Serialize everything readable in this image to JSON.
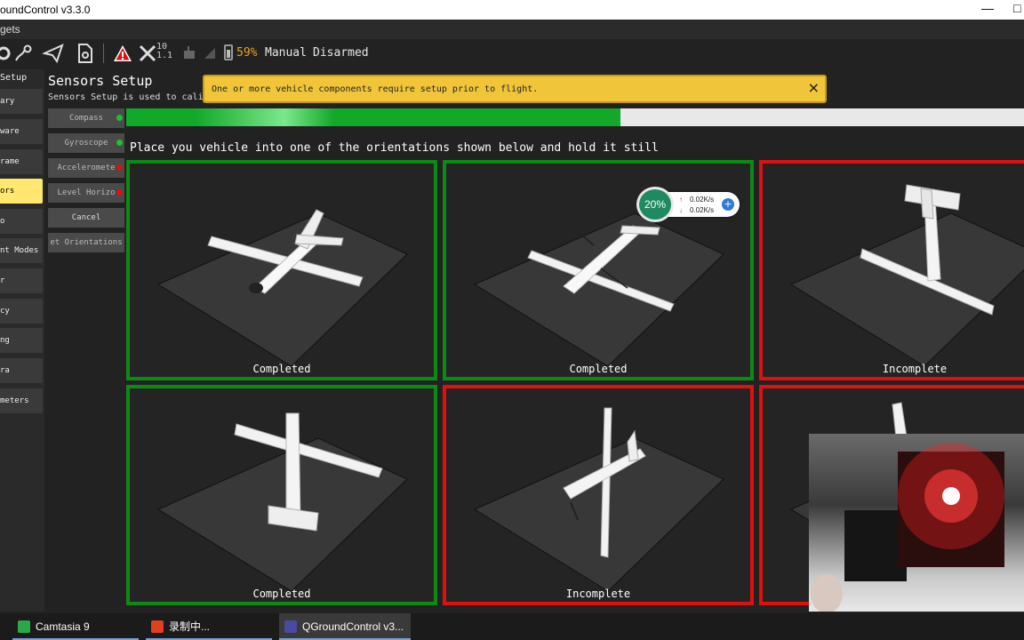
{
  "window": {
    "title": "oundControl v3.3.0",
    "min": "—",
    "max": "□"
  },
  "menubar": {
    "label": "gets"
  },
  "toolbar": {
    "gps_sats": "10",
    "gps_hdop": "1.1",
    "battery_pct": "59%",
    "flight_mode": "Manual",
    "arm_state": "Disarmed",
    "icons": [
      "gear-icon",
      "waypoint-icon",
      "send-icon",
      "document-icon",
      "warning-icon",
      "gps-icon",
      "signal-icon",
      "battery-icon"
    ]
  },
  "nav": {
    "header": "Setup",
    "items": [
      "ary",
      "ware",
      "rame",
      "ors",
      "o",
      "nt Modes",
      "r",
      "cy",
      "ng",
      "ra",
      "meters"
    ],
    "active_index": 3
  },
  "subnav": {
    "items": [
      {
        "label": "Compass",
        "status": "ok"
      },
      {
        "label": "Gyroscope",
        "status": "ok"
      },
      {
        "label": "Acceleromete",
        "status": "needed"
      },
      {
        "label": "Level Horizo",
        "status": "needed"
      },
      {
        "label": "Cancel",
        "status": ""
      },
      {
        "label": "et Orientations",
        "status": ""
      }
    ]
  },
  "page": {
    "title": "Sensors Setup",
    "description": "Sensors Setup is used to calibr",
    "banner": "One or more vehicle components require setup prior to flight.",
    "banner_close": "×",
    "progress": 0.55,
    "instruction": "Place you vehicle into one of the orientations shown below and hold it still"
  },
  "orientations": [
    {
      "status": "Completed",
      "done": true,
      "pose": "level"
    },
    {
      "status": "Completed",
      "done": true,
      "pose": "upside-down"
    },
    {
      "status": "Incomplete",
      "done": false,
      "pose": "nose-down"
    },
    {
      "status": "Completed",
      "done": true,
      "pose": "nose-up"
    },
    {
      "status": "Incomplete",
      "done": false,
      "pose": "left-side"
    },
    {
      "status": "",
      "done": false,
      "pose": "right-side"
    }
  ],
  "netspeed": {
    "percent": "20%",
    "up": "0.02K/s",
    "down": "0.02K/s"
  },
  "taskbar": {
    "items": [
      {
        "label": "Camtasia 9",
        "color": "#2aa84a"
      },
      {
        "label": "录制中...",
        "color": "#e04020"
      },
      {
        "label": "QGroundControl v3...",
        "color": "#4a4aa0"
      }
    ]
  },
  "colors": {
    "complete": "#0c8a14",
    "incomplete": "#e01010",
    "active_nav": "#ffe770",
    "banner": "#f0c53a"
  }
}
